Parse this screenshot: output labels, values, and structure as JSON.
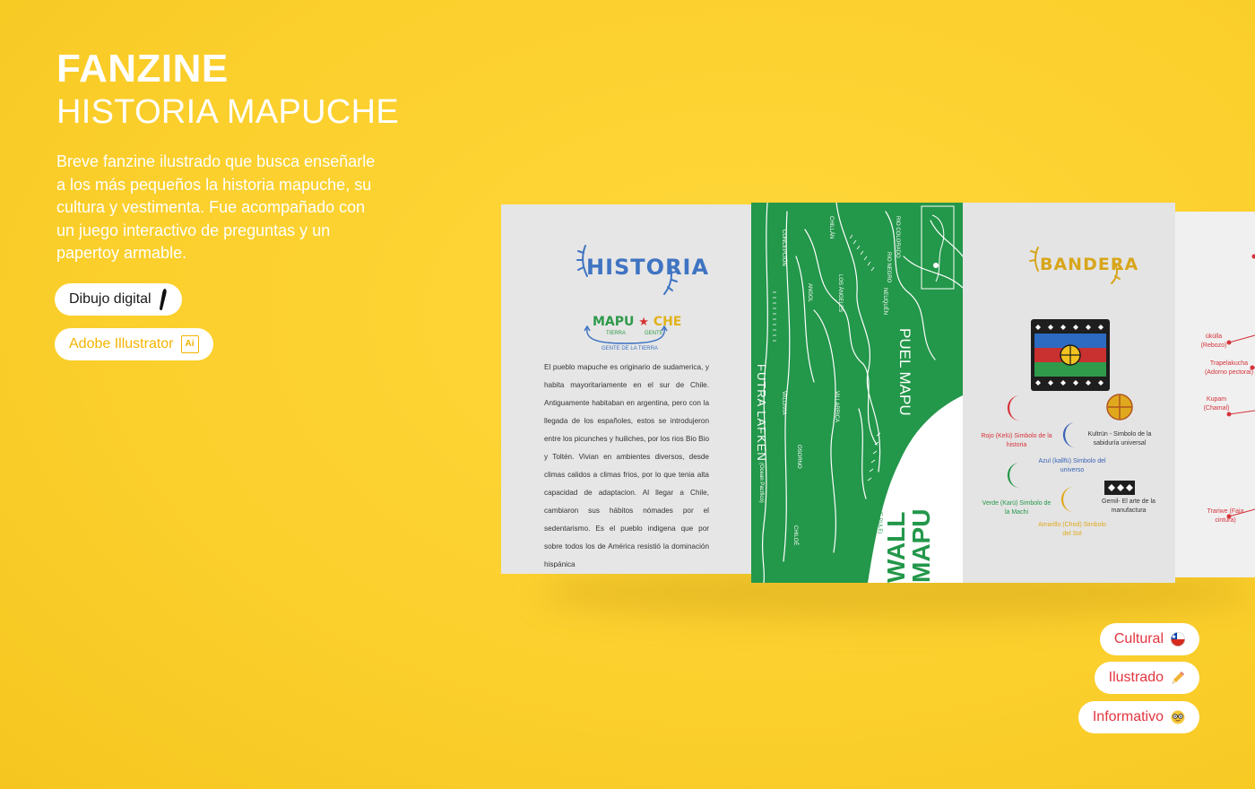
{
  "header": {
    "title": "FANZINE",
    "subtitle": "HISTORIA MAPUCHE"
  },
  "description": "Breve fanzine ilustrado que busca enseñarle a los más pequeños la historia mapuche, su cultura y vestimenta. Fue acompañado con un juego interactivo de preguntas y un papertoy armable.",
  "tools": [
    {
      "label": "Dibujo digital",
      "icon": "brush-stroke-icon"
    },
    {
      "label": "Adobe Illustrator",
      "icon": "adobe-illustrator-icon",
      "icon_text": "Ai"
    }
  ],
  "tags": [
    {
      "label": "Cultural",
      "icon": "chile-flag-icon"
    },
    {
      "label": "Ilustrado",
      "icon": "pencil-icon"
    },
    {
      "label": "Informativo",
      "icon": "nerd-face-icon"
    }
  ],
  "colors": {
    "background": "#fbcf2c",
    "green": "#23974a",
    "red": "#e2363f",
    "blue": "#3f74c2",
    "illustrator": "#f4b400"
  },
  "fanzine": {
    "historia": {
      "heading": "HISTORIA",
      "mapu": "MAPU",
      "che": "CHE",
      "tierra": "TIERRA",
      "gente": "GENTE",
      "gente_de_la_tierra": "GENTE DE LA TIERRA",
      "body": "El pueblo mapuche es originario de sudamerica, y habita mayoritariamente en el sur de Chile. Antiguamente habitaban en argentina, pero con la llegada de los españoles, estos se introdujeron entre los picunches y huiliches, por los rios Bio Bio y Toltén. Vivian en ambientes diversos, desde climas calidos a climas frios, por lo que tenia alta capacidad de adaptacion. Al llegar a Chile, cambiaron sus hábitos nómades por el sedentarismo. Es el pueblo indigena que por sobre todos los de América resistió la dominación hispánica"
    },
    "mapa": {
      "puel_mapu": "PUEL MAPU",
      "futra_lafken": "FUTRA LAFKEN",
      "futra_sub": "(Ocean Pacífico)",
      "wall_mapu": "WALL MAPU",
      "wall_sub": "(MAPUCHE PULE)",
      "places": [
        "CONCEPCIÓN",
        "CHILLÁN",
        "LOS ÁNGELES",
        "ANGOL",
        "VALDIVIA",
        "OSORNO",
        "VILLARRICA",
        "CHILOÉ",
        "RIO NEGRO",
        "RIO COLORADO",
        "NEUQUÉN"
      ]
    },
    "bandera": {
      "heading": "BANDERA",
      "items": [
        {
          "text": "Rojo (Kelü) Simbolo de la historia",
          "color": "red"
        },
        {
          "text": "Kultrün - Simbolo de la sabiduría universal",
          "color": "dark"
        },
        {
          "text": "Azul (kallfü) Simbolo del universo",
          "color": "blue"
        },
        {
          "text": "Verde (Karü) Simbolo de la Machi",
          "color": "green"
        },
        {
          "text": "Gemil- El arte de la manufactura",
          "color": "dark"
        },
        {
          "text": "Amarillo (Chod) Simbolo del Sol",
          "color": "yellow"
        }
      ]
    },
    "vestimenta": {
      "items": [
        "ükülla (Rebozo)",
        "Trapelakucha (Adorno pectoral)",
        "Kupam (Chamal)",
        "Trariwe (Faja cintura)"
      ]
    }
  }
}
